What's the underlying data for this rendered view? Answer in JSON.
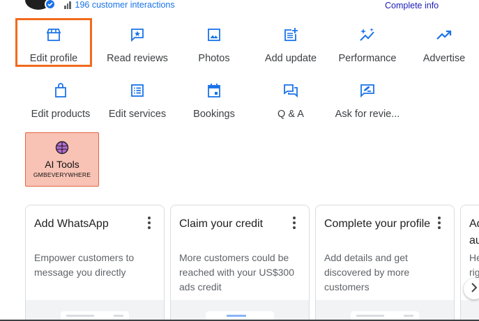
{
  "header": {
    "interactions": "196 customer interactions",
    "complete_info": "Complete info"
  },
  "actions": [
    {
      "label": "Edit profile",
      "icon": "storefront-icon"
    },
    {
      "label": "Read reviews",
      "icon": "review-star-icon"
    },
    {
      "label": "Photos",
      "icon": "photo-icon"
    },
    {
      "label": "Add update",
      "icon": "post-add-icon"
    },
    {
      "label": "Performance",
      "icon": "sparkle-trend-icon"
    },
    {
      "label": "Advertise",
      "icon": "trending-up-icon"
    },
    {
      "label": "Edit products",
      "icon": "shopping-bag-icon"
    },
    {
      "label": "Edit services",
      "icon": "list-icon"
    },
    {
      "label": "Bookings",
      "icon": "calendar-icon"
    },
    {
      "label": "Q & A",
      "icon": "chat-bubbles-icon"
    },
    {
      "label": "Ask for revie...",
      "icon": "rate-review-icon"
    }
  ],
  "ai_tools": {
    "title": "AI Tools",
    "subtitle": "GMBEVERYWHERE"
  },
  "cards": [
    {
      "title": "Add WhatsApp",
      "desc": "Empower customers to message you directly"
    },
    {
      "title": "Claim your credit",
      "desc": "More customers could be reached with your US$300 ads credit"
    },
    {
      "title": "Complete your profile",
      "desc": "Add details and get discovered by more customers"
    },
    {
      "title": "Ad au",
      "desc": "He rig"
    }
  ],
  "colors": {
    "accent": "#1a73e8",
    "highlight_border": "#f26a1b",
    "ai_bg": "#f8c2b4"
  }
}
